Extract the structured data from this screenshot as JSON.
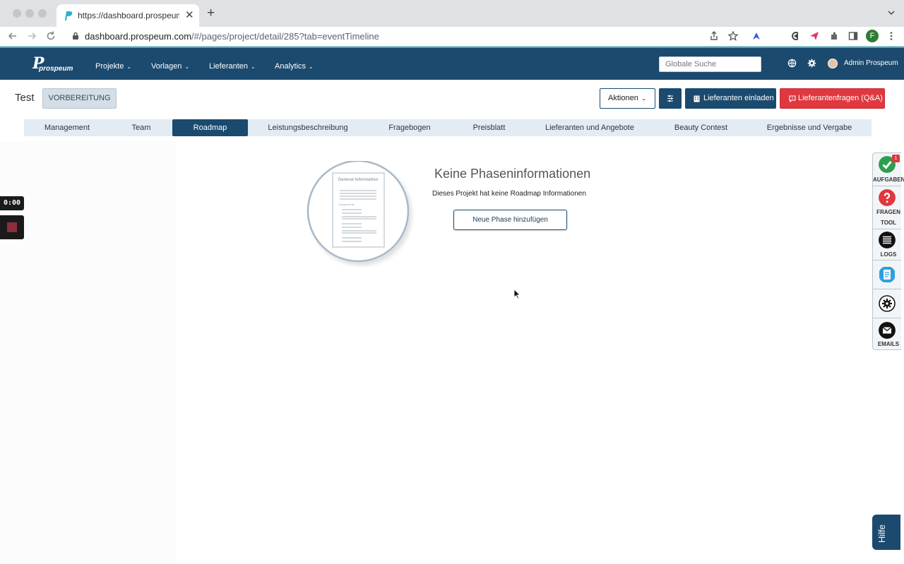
{
  "browser": {
    "tab_title": "https://dashboard.prospeum.com",
    "tab_close": "✕",
    "new_tab": "+",
    "url_host": "dashboard.prospeum.com",
    "url_path": "/#/pages/project/detail/285?tab=eventTimeline",
    "profile_initial": "F"
  },
  "app": {
    "logo_mark": "P",
    "logo_word": "prospeum",
    "menu": [
      {
        "label": "Projekte"
      },
      {
        "label": "Vorlagen"
      },
      {
        "label": "Lieferanten"
      },
      {
        "label": "Analytics"
      }
    ],
    "search_placeholder": "Globale Suche",
    "user_name": "Admin Prospeum"
  },
  "project": {
    "title": "Test",
    "status": "VORBEREITUNG",
    "actions_label": "Aktionen",
    "invite_label": "Lieferanten einladen",
    "qa_label": "Lieferantenfragen (Q&A)"
  },
  "tabs": [
    {
      "label": "Management"
    },
    {
      "label": "Team"
    },
    {
      "label": "Roadmap"
    },
    {
      "label": "Leistungsbeschreibung"
    },
    {
      "label": "Fragebogen"
    },
    {
      "label": "Preisblatt"
    },
    {
      "label": "Lieferanten und Angebote"
    },
    {
      "label": "Beauty Contest"
    },
    {
      "label": "Ergebnisse und Vergabe"
    }
  ],
  "active_tab": "Roadmap",
  "empty_state": {
    "illustration_title": "General Information",
    "illustration_section": "Components",
    "title": "Keine Phaseninformationen",
    "text": "Dieses Projekt hat keine Roadmap Informationen",
    "button": "Neue Phase hinzufügen"
  },
  "recording": {
    "time": "0:00"
  },
  "side_panel": {
    "tasks_label": "AUFGABEN",
    "tasks_badge": "1",
    "questions_label_1": "FRAGEN",
    "questions_label_2": "TOOL",
    "logs_label": "LOGS",
    "emails_label": "EMAILS"
  },
  "help_label": "Hilfe",
  "colors": {
    "primary": "#1b4a6e",
    "accent_line": "#2bb3c9",
    "danger": "#e0383e",
    "success": "#2e9e4e",
    "tab_bg": "#e3ecf2"
  }
}
